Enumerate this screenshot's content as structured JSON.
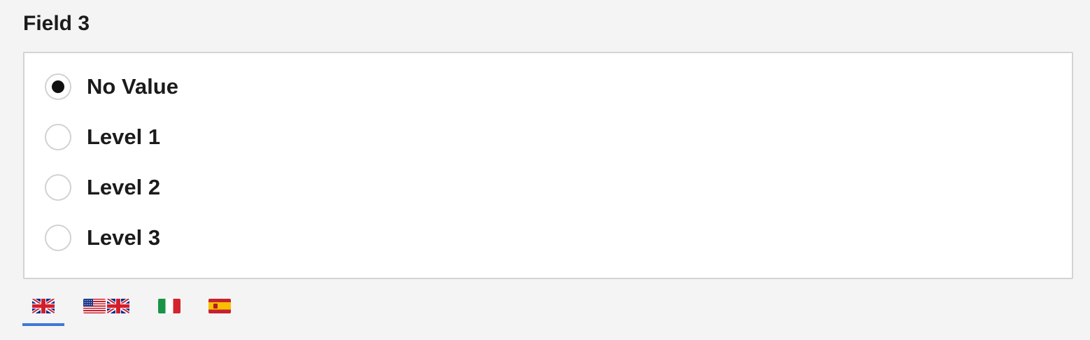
{
  "field": {
    "label": "Field 3",
    "options": [
      {
        "label": "No Value",
        "checked": true
      },
      {
        "label": "Level 1",
        "checked": false
      },
      {
        "label": "Level 2",
        "checked": false
      },
      {
        "label": "Level 3",
        "checked": false
      }
    ]
  },
  "language_tabs": [
    {
      "flags": [
        "uk-flag-icon"
      ],
      "active": true
    },
    {
      "flags": [
        "us-flag-icon",
        "uk-flag-icon"
      ],
      "active": false
    },
    {
      "flags": [
        "italy-flag-icon"
      ],
      "active": false
    },
    {
      "flags": [
        "spain-flag-icon"
      ],
      "active": false
    }
  ],
  "colors": {
    "active_tab_underline": "#3c78d8",
    "radio_border": "#d2d2d2",
    "box_border": "#d3d3d3"
  }
}
